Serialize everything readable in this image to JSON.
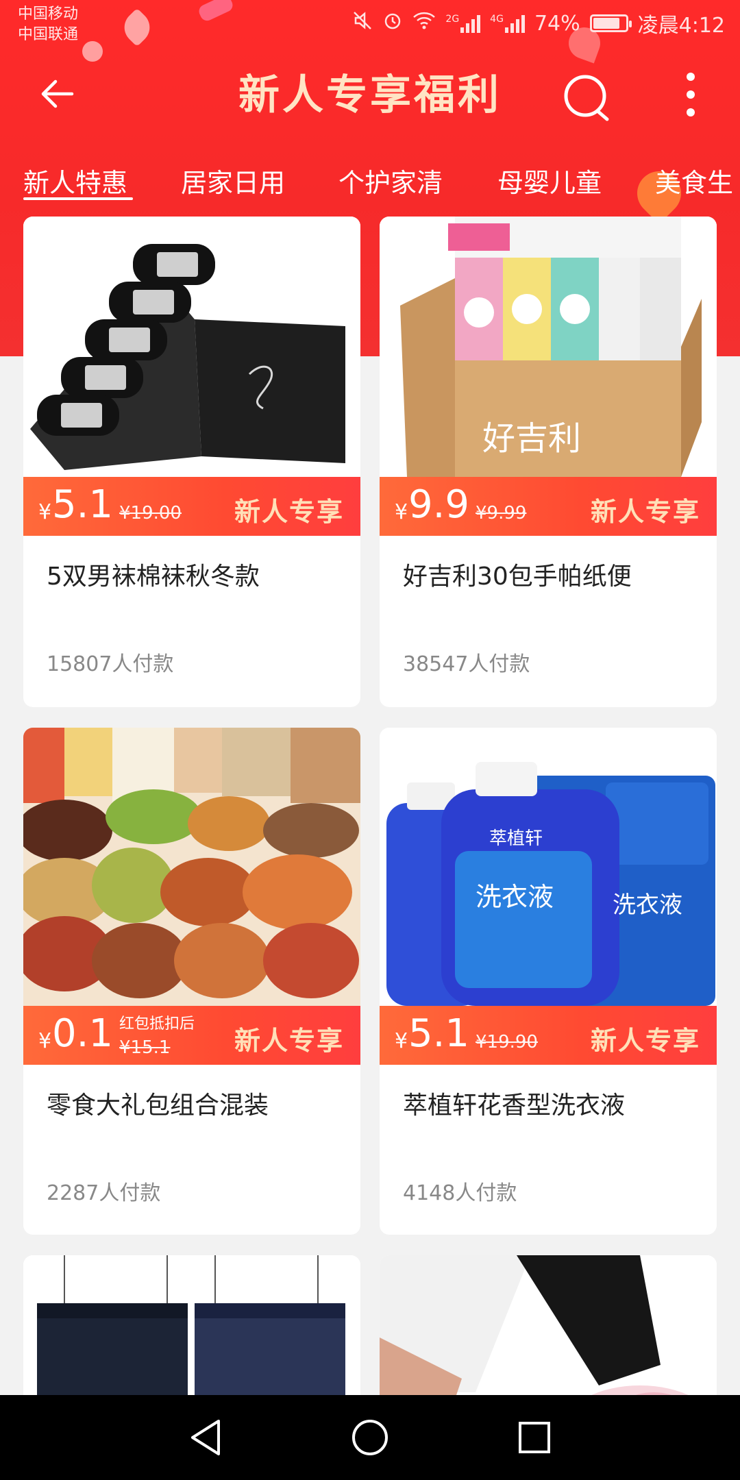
{
  "status_bar": {
    "carrier_1": "中国移动",
    "carrier_2": "中国联通",
    "net_1": "2G",
    "net_2": "4G",
    "battery": "74%",
    "time": "凌晨4:12"
  },
  "header": {
    "title": "新人专享福利"
  },
  "tabs": [
    {
      "label": "新人特惠"
    },
    {
      "label": "居家日用"
    },
    {
      "label": "个护家清"
    },
    {
      "label": "母婴儿童"
    },
    {
      "label": "美食生"
    }
  ],
  "products": [
    {
      "currency": "¥",
      "price": "5.1",
      "original_price": "¥19.00",
      "note": "",
      "badge": "新人专享",
      "name": "5双男袜棉袜秋冬款",
      "sold": "15807人付款"
    },
    {
      "currency": "¥",
      "price": "9.9",
      "original_price": "¥9.99",
      "note": "",
      "badge": "新人专享",
      "name": "好吉利30包手帕纸便",
      "sold": "38547人付款"
    },
    {
      "currency": "¥",
      "price": "0.1",
      "original_price": "¥15.1",
      "note": "红包抵扣后",
      "badge": "新人专享",
      "name": "零食大礼包组合混装",
      "sold": "2287人付款"
    },
    {
      "currency": "¥",
      "price": "5.1",
      "original_price": "¥19.90",
      "note": "",
      "badge": "新人专享",
      "name": "萃植轩花香型洗衣液",
      "sold": "4148人付款"
    }
  ],
  "product_images": {
    "socks_caption": "好吉利",
    "detergent_label": "洗衣液",
    "detergent_brand": "萃植轩"
  },
  "colors": {
    "brand_red": "#f72a2a",
    "price_band_start": "#ff6a3a",
    "price_band_end": "#ff3e3e",
    "badge_text": "#ffe0b8",
    "title_text": "#ffe4c4"
  }
}
